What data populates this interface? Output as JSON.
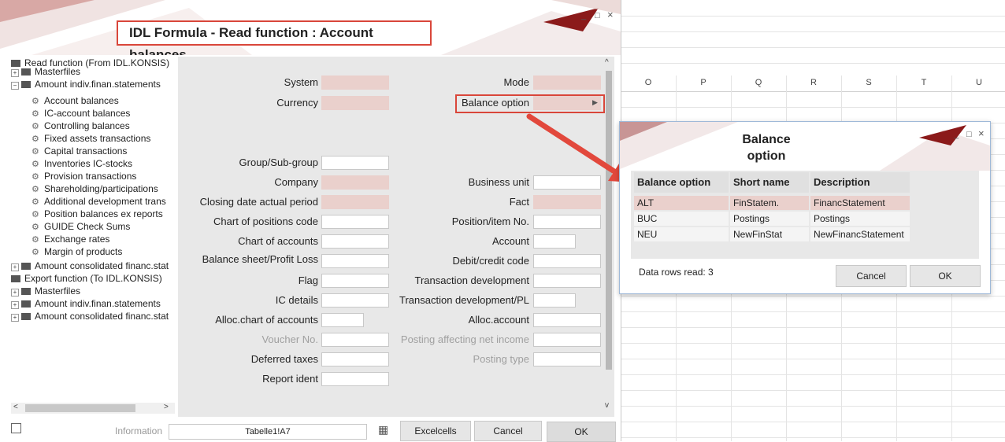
{
  "spreadsheet": {
    "columns": [
      "O",
      "P",
      "Q",
      "R",
      "S",
      "T",
      "U"
    ]
  },
  "dialog": {
    "title": "IDL Formula - Read function : Account balances",
    "window_controls": {
      "minimize": "_",
      "maximize": "□",
      "close": "×"
    }
  },
  "tree": {
    "items": [
      {
        "label": "Read function (From IDL.KONSIS)",
        "level": 0
      },
      {
        "label": "Masterfiles",
        "level": 1
      },
      {
        "label": "Amount indiv.finan.statements",
        "level": 1
      },
      {
        "label": "Account balances",
        "level": 2
      },
      {
        "label": "IC-account balances",
        "level": 2
      },
      {
        "label": "Controlling balances",
        "level": 2
      },
      {
        "label": "Fixed assets transactions",
        "level": 2
      },
      {
        "label": "Capital transactions",
        "level": 2
      },
      {
        "label": "Inventories IC-stocks",
        "level": 2
      },
      {
        "label": "Provision transactions",
        "level": 2
      },
      {
        "label": "Shareholding/participations",
        "level": 2
      },
      {
        "label": "Additional development trans",
        "level": 2
      },
      {
        "label": "Position balances ex reports",
        "level": 2
      },
      {
        "label": "GUIDE Check Sums",
        "level": 2
      },
      {
        "label": "Exchange rates",
        "level": 2
      },
      {
        "label": "Margin of products",
        "level": 2
      },
      {
        "label": "Amount consolidated financ.stat",
        "level": 1
      },
      {
        "label": "Export function (To IDL.KONSIS)",
        "level": 0
      },
      {
        "label": "Masterfiles",
        "level": 1
      },
      {
        "label": "Amount indiv.finan.statements",
        "level": 1
      },
      {
        "label": "Amount consolidated financ.stat",
        "level": 1
      }
    ]
  },
  "form": {
    "left": [
      {
        "label": "System"
      },
      {
        "label": "Currency"
      },
      {
        "label": "Group/Sub-group"
      },
      {
        "label": "Company"
      },
      {
        "label": "Closing date actual period"
      },
      {
        "label": "Chart of positions code"
      },
      {
        "label": "Chart of accounts"
      },
      {
        "label": "Balance sheet/Profit  Loss"
      },
      {
        "label": "Flag"
      },
      {
        "label": "IC details"
      },
      {
        "label": "Alloc.chart of accounts"
      },
      {
        "label": "Voucher No."
      },
      {
        "label": "Deferred taxes"
      },
      {
        "label": "Report ident"
      }
    ],
    "right": [
      {
        "label": "Mode"
      },
      {
        "label": "Balance option"
      },
      {
        "label": "Business unit"
      },
      {
        "label": "Fact"
      },
      {
        "label": "Position/item No."
      },
      {
        "label": "Account"
      },
      {
        "label": "Debit/credit code"
      },
      {
        "label": "Transaction development"
      },
      {
        "label": "Transaction development/PL"
      },
      {
        "label": "Alloc.account"
      },
      {
        "label": "Posting affecting net income"
      },
      {
        "label": "Posting type"
      }
    ]
  },
  "bottom": {
    "information_label": "Information",
    "information_value": "Tabelle1!A7",
    "excelcells": "Excelcells",
    "cancel": "Cancel",
    "ok": "OK"
  },
  "popup": {
    "title_line1": "Balance",
    "title_line2": "option",
    "headers": [
      "Balance option",
      "Short name",
      "Description"
    ],
    "rows": [
      [
        "ALT",
        "FinStatem.",
        "FinancStatement"
      ],
      [
        "BUC",
        "Postings",
        "Postings"
      ],
      [
        "NEU",
        "NewFinStat",
        "NewFinancStatement"
      ]
    ],
    "status": "Data rows read: 3",
    "cancel": "Cancel",
    "ok": "OK"
  },
  "colors": {
    "accent_red": "#d9463a",
    "pink_field": "#ead0cc",
    "panel_gray": "#e8e8e8",
    "banner_dark_red": "#8b1a1a"
  }
}
